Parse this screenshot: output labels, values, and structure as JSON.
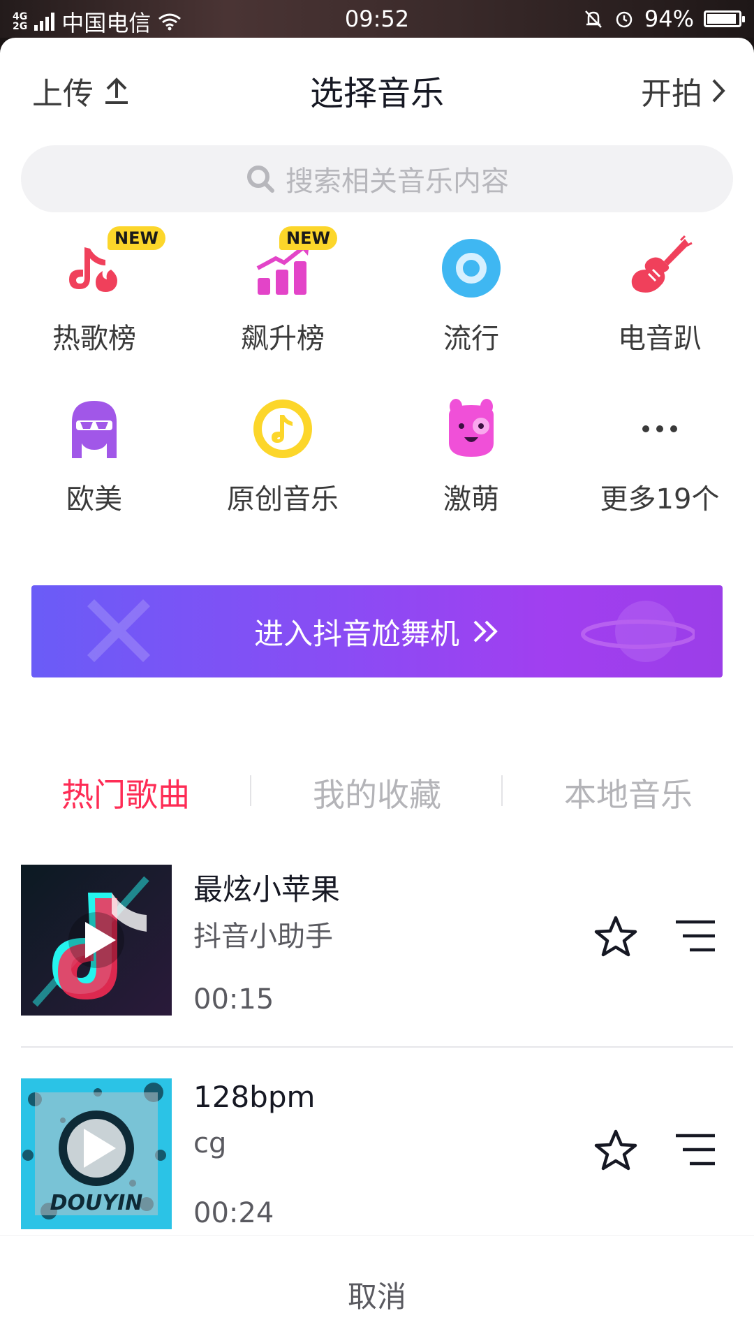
{
  "status_bar": {
    "network_top": "4G",
    "network_bottom": "2G",
    "carrier": "中国电信",
    "time": "09:52",
    "battery_percent": "94%",
    "battery_level": 0.94
  },
  "header": {
    "upload_label": "上传",
    "title": "选择音乐",
    "start_label": "开拍"
  },
  "search": {
    "placeholder": "搜索相关音乐内容"
  },
  "categories": [
    {
      "label": "热歌榜",
      "badge": "NEW",
      "icon": "hot-chart-icon"
    },
    {
      "label": "飙升榜",
      "badge": "NEW",
      "icon": "rising-chart-icon"
    },
    {
      "label": "流行",
      "icon": "pop-disc-icon"
    },
    {
      "label": "电音趴",
      "icon": "electric-guitar-icon"
    },
    {
      "label": "欧美",
      "icon": "western-avatar-icon"
    },
    {
      "label": "原创音乐",
      "icon": "original-music-icon"
    },
    {
      "label": "激萌",
      "icon": "cute-creature-icon"
    },
    {
      "label": "更多19个",
      "icon": "more-dots-icon"
    }
  ],
  "banner": {
    "label": "进入抖音尬舞机"
  },
  "tabs": [
    {
      "label": "热门歌曲",
      "active": true
    },
    {
      "label": "我的收藏",
      "active": false
    },
    {
      "label": "本地音乐",
      "active": false
    }
  ],
  "songs": [
    {
      "title": "最炫小苹果",
      "artist": "抖音小助手",
      "duration": "00:15",
      "cover": "douyin-logo-cover"
    },
    {
      "title": "128bpm",
      "artist": "cg",
      "duration": "00:24",
      "cover": "douyin-grunge-cover",
      "cover_text": "DOUYIN"
    }
  ],
  "footer": {
    "cancel_label": "取消"
  },
  "colors": {
    "accent": "#fe2c55",
    "banner_start": "#6a5cf7",
    "banner_end": "#a13ff0",
    "badge": "#fcd62a"
  }
}
